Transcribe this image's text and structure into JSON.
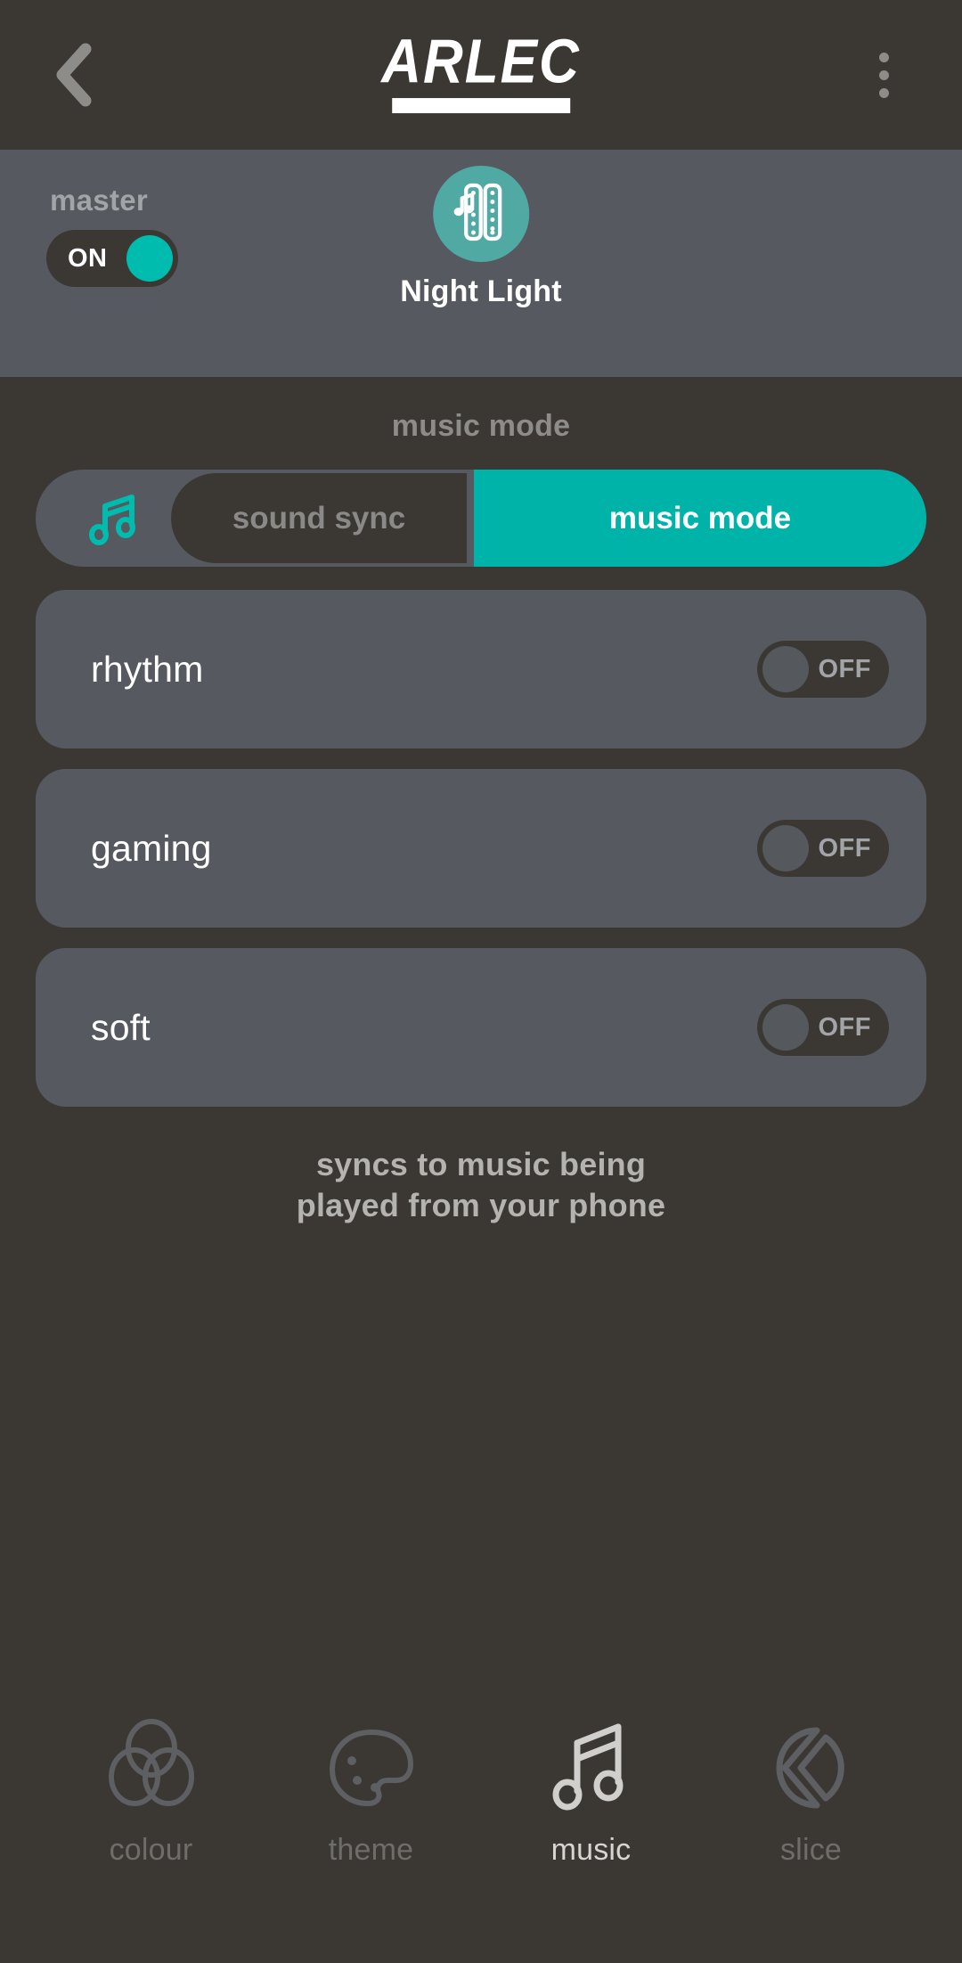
{
  "header": {
    "back_icon": "chevron-left-icon",
    "logo_text": "ARLEC",
    "menu_icon": "kebab-menu-icon"
  },
  "device": {
    "master_label": "master",
    "master_switch_state": "ON",
    "device_icon": "night-light-music-strip-icon",
    "device_name": "Night Light"
  },
  "main": {
    "section_title": "music mode",
    "segmented": {
      "icon": "music-note-icon",
      "options": [
        {
          "label": "sound sync",
          "active": false
        },
        {
          "label": "music mode",
          "active": true
        }
      ]
    },
    "cards": [
      {
        "label": "rhythm",
        "state": "OFF"
      },
      {
        "label": "gaming",
        "state": "OFF"
      },
      {
        "label": "soft",
        "state": "OFF"
      }
    ],
    "description_line1": "syncs to music being",
    "description_line2": "played from your phone"
  },
  "bottom_nav": [
    {
      "label": "colour",
      "icon": "overlapping-circles-icon",
      "active": false
    },
    {
      "label": "theme",
      "icon": "paint-palette-icon",
      "active": false
    },
    {
      "label": "music",
      "icon": "music-note-icon",
      "active": true
    },
    {
      "label": "slice",
      "icon": "pie-slice-icon",
      "active": false
    }
  ],
  "colors": {
    "background": "#3b3833",
    "panel": "#565a60",
    "accent_teal": "#00b3a8",
    "accent_teal_bright": "#00bcae",
    "icon_teal": "#51a9a4",
    "muted_text": "#8d8c89"
  }
}
